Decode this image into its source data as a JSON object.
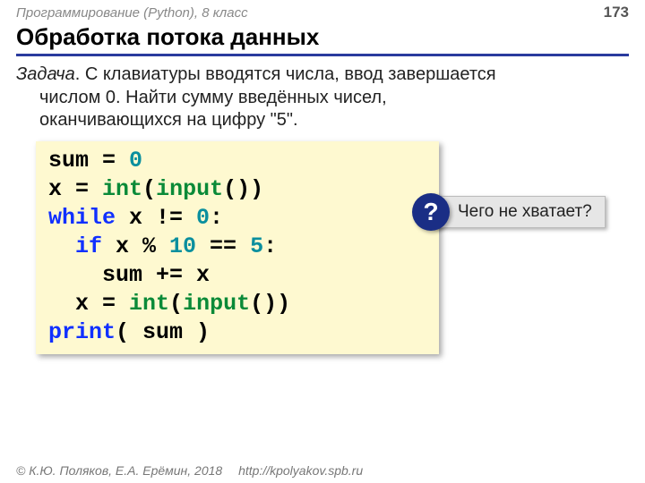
{
  "header": {
    "course": "Программирование (Python), 8 класс",
    "page": "173"
  },
  "title": "Обработка потока данных",
  "task": {
    "label": "Задача",
    "line1": ". С клавиатуры вводятся числа, ввод завершается ",
    "line2": "числом 0. Найти сумму введённых чисел, ",
    "line3": "оканчивающихся на цифру \"5\"."
  },
  "code": {
    "l1a": "sum",
    "l1b": " = ",
    "l1c": "0",
    "l2a": "x",
    "l2b": " = ",
    "l2c": "int",
    "l2d": "(",
    "l2e": "input",
    "l2f": "())",
    "l3a": "while ",
    "l3b": "x != ",
    "l3c": "0",
    "l3d": ":",
    "l4a": "  if ",
    "l4b": "x % ",
    "l4c": "10",
    "l4d": " == ",
    "l4e": "5",
    "l4f": ":",
    "l5": "    sum += x",
    "l6a": "  x",
    "l6b": " = ",
    "l6c": "int",
    "l6d": "(",
    "l6e": "input",
    "l6f": "())",
    "l7a": "print",
    "l7b": "( sum )"
  },
  "callout": {
    "badge": "?",
    "text": "Чего не хватает?"
  },
  "footer": {
    "copyright": "© К.Ю. Поляков, Е.А. Ерёмин, 2018",
    "link": "http://kpolyakov.spb.ru"
  }
}
